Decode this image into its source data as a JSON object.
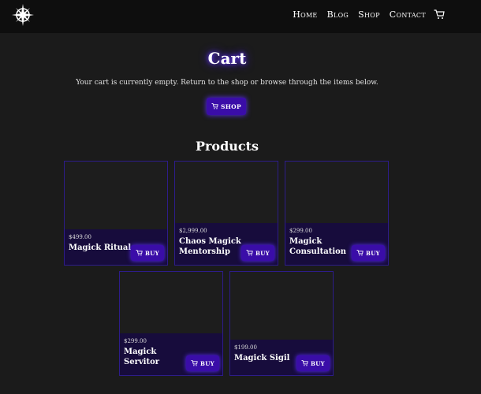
{
  "nav": {
    "items": [
      "Home",
      "Blog",
      "Shop",
      "Contact"
    ]
  },
  "cart": {
    "title": "Cart",
    "message": "Your cart is currently empty. Return to the shop or browse through the items below.",
    "shop_button": "SHOP"
  },
  "products": {
    "title": "Products",
    "buy_label": "BUY",
    "items": [
      {
        "price": "$499.00",
        "name": "Magick Ritual"
      },
      {
        "price": "$2,999.00",
        "name": "Chaos Magick Mentorship"
      },
      {
        "price": "$299.00",
        "name": "Magick Consultation"
      },
      {
        "price": "$299.00",
        "name": "Magick Servitor"
      },
      {
        "price": "$199.00",
        "name": "Magick Sigil"
      }
    ]
  },
  "colors": {
    "accent": "#3a0da8",
    "glow": "#5b2cff",
    "card_footer": "#170c3c"
  }
}
